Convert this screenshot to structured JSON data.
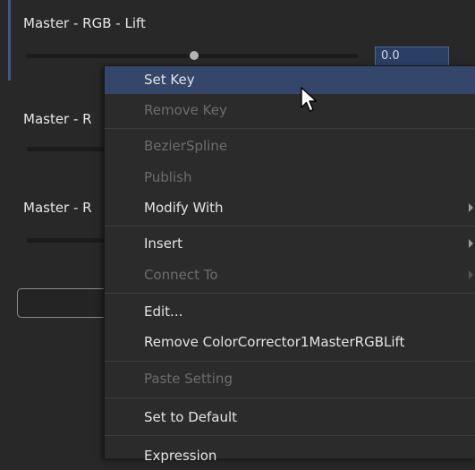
{
  "controls": [
    {
      "title": "Master - RGB - Lift",
      "value": "0.0"
    },
    {
      "title": "Master - R"
    },
    {
      "title": "Master - R"
    }
  ],
  "menu": {
    "items": [
      {
        "label": "Set Key",
        "enabled": true,
        "highlighted": true
      },
      {
        "label": "Remove Key",
        "enabled": false
      },
      {
        "label": "BezierSpline",
        "enabled": false
      },
      {
        "label": "Publish",
        "enabled": false
      },
      {
        "label": "Modify With",
        "enabled": true,
        "submenu": true
      },
      {
        "label": "Insert",
        "enabled": true,
        "submenu": true
      },
      {
        "label": "Connect To",
        "enabled": false,
        "submenu": true
      },
      {
        "label": "Edit...",
        "enabled": true
      },
      {
        "label": "Remove ColorCorrector1MasterRGBLift",
        "enabled": true
      },
      {
        "label": "Paste Setting",
        "enabled": false
      },
      {
        "label": "Set to Default",
        "enabled": true
      },
      {
        "label": "Expression",
        "enabled": true
      }
    ]
  },
  "colors": {
    "background": "#282828",
    "menu_background": "#2b2b2b",
    "highlight": "#34466a",
    "accent": "#3e5a8a"
  },
  "icons": {
    "cursor": "mouse-pointer-icon",
    "submenu": "chevron-right-icon"
  }
}
